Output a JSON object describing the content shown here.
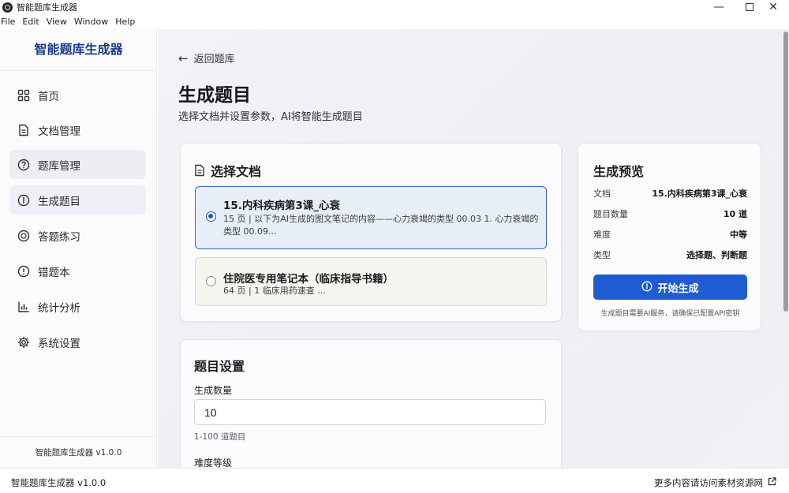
{
  "window": {
    "title": "智能题库生成器"
  },
  "menu": [
    "File",
    "Edit",
    "View",
    "Window",
    "Help"
  ],
  "sidebar": {
    "brand": "智能题库生成器",
    "items": [
      {
        "label": "首页",
        "icon": "grid-icon"
      },
      {
        "label": "文档管理",
        "icon": "document-icon"
      },
      {
        "label": "题库管理",
        "icon": "question-circle-icon"
      },
      {
        "label": "生成题目",
        "icon": "sparkle-circle-icon"
      },
      {
        "label": "答题练习",
        "icon": "target-icon"
      },
      {
        "label": "错题本",
        "icon": "alert-circle-icon"
      },
      {
        "label": "统计分析",
        "icon": "bar-chart-icon"
      },
      {
        "label": "系统设置",
        "icon": "gear-icon"
      }
    ],
    "footer": "智能题库生成器 v1.0.0"
  },
  "main": {
    "back_label": "返回题库",
    "title": "生成题目",
    "description": "选择文档并设置参数，AI将智能生成题目",
    "docs_card": {
      "heading": "选择文档",
      "docs": [
        {
          "title": "15.内科疾病第3课_心衰",
          "meta": "15 页 | 以下为AI生成的图文笔记的内容——心力衰竭的类型 00.03 1. 心力衰竭的类型 00.09...",
          "selected": true
        },
        {
          "title": "住院医专用笔记本（临床指导书籍）",
          "meta": "64 页 | 1 临床用药速查 ...",
          "selected": false
        }
      ]
    },
    "settings_card": {
      "heading": "题目设置",
      "count_label": "生成数量",
      "count_value": "10",
      "count_hint": "1-100 道题目",
      "difficulty_label": "难度等级"
    },
    "preview_card": {
      "heading": "生成预览",
      "rows": [
        {
          "label": "文档",
          "value": "15.内科疾病第3课_心衰"
        },
        {
          "label": "题目数量",
          "value": "10 道"
        },
        {
          "label": "难度",
          "value": "中等"
        },
        {
          "label": "类型",
          "value": "选择题、判断题"
        }
      ],
      "button_label": "开始生成",
      "note": "生成题目需要AI服务，请确保已配置API密钥"
    }
  },
  "statusbar": {
    "left": "智能题库生成器 v1.0.0",
    "right": "更多内容请访问素材资源网"
  },
  "colors": {
    "accent": "#1f5bd1",
    "brand": "#1c3c8c"
  }
}
